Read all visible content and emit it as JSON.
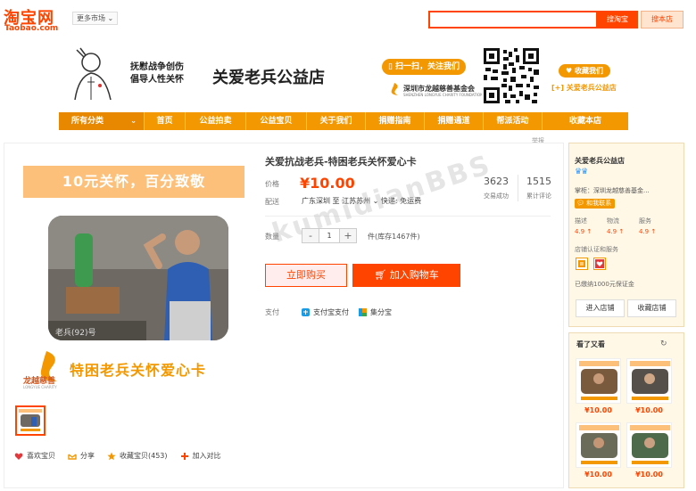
{
  "top": {
    "logo_cn": "淘宝网",
    "logo_en": "Taobao.com",
    "market_button": "更多市场",
    "search_taobao": "搜淘宝",
    "search_store": "搜本店"
  },
  "banner": {
    "slogan_line1": "抚慰战争创伤",
    "slogan_line2": "倡导人性关怀",
    "shop_name": "关爱老兵公益店",
    "scan_label": "扫一扫，关注我们",
    "foundation_name": "深圳市龙越慈善基金会",
    "foundation_en": "SHENZHEN LONGYUE CHARITY FOUNDATION",
    "favorite_badge": "收藏我们",
    "favorite_link": "[+] 关爱老兵公益店"
  },
  "nav": {
    "items": [
      "所有分类",
      "首页",
      "公益拍卖",
      "公益宝贝",
      "关于我们",
      "捐赠指南",
      "捐赠通道",
      "帮派活动",
      "收藏本店"
    ]
  },
  "gallery": {
    "promo": "10元关怀，百分致敬",
    "photo_caption": "老兵(92)号",
    "brand_name": "龙越慈善",
    "brand_en": "LONGYUE CHARITY",
    "card_title": "特困老兵关怀爱心卡"
  },
  "actions": {
    "like": "喜欢宝贝",
    "share": "分享",
    "collect": "收藏宝贝(453)",
    "compare": "加入对比"
  },
  "detail": {
    "report": "举报",
    "title": "关爱抗战老兵-特困老兵关怀爱心卡",
    "price_label": "价格",
    "price": "¥10.00",
    "shipping_label": "配送",
    "ship_from": "广东深圳",
    "ship_to_word": "至",
    "ship_to": "江苏苏州",
    "ship_method": "快递: 免运费",
    "sales_count": "3623",
    "sales_label": "交易成功",
    "review_count": "1515",
    "review_label": "累计评论",
    "qty_label": "数量",
    "qty_value": "1",
    "qty_minus": "-",
    "qty_plus": "+",
    "stock": "件(库存1467件)",
    "buy_now": "立即购买",
    "add_cart": "加入购物车",
    "pay_label": "支付",
    "pay_alipay": "支付宝支付",
    "pay_jifen": "集分宝",
    "watermark": "kumidianBBS"
  },
  "shop": {
    "name": "关爱老兵公益店",
    "crowns": "♛♛",
    "owner": "掌柜：深圳龙越慈善基金...",
    "contact": "和我联系",
    "dsr_labels": [
      "描述",
      "物流",
      "服务"
    ],
    "dsr_values": [
      "4.9 ↑",
      "4.9 ↑",
      "4.9 ↑"
    ],
    "cert_label": "店铺认证和服务",
    "deposit": "已缴纳1000元保证金",
    "enter_shop": "进入店铺",
    "collect_shop": "收藏店铺"
  },
  "recommend": {
    "title": "看了又看",
    "items": [
      {
        "price": "¥10.00"
      },
      {
        "price": "¥10.00"
      },
      {
        "price": "¥10.00"
      },
      {
        "price": "¥10.00"
      }
    ]
  }
}
